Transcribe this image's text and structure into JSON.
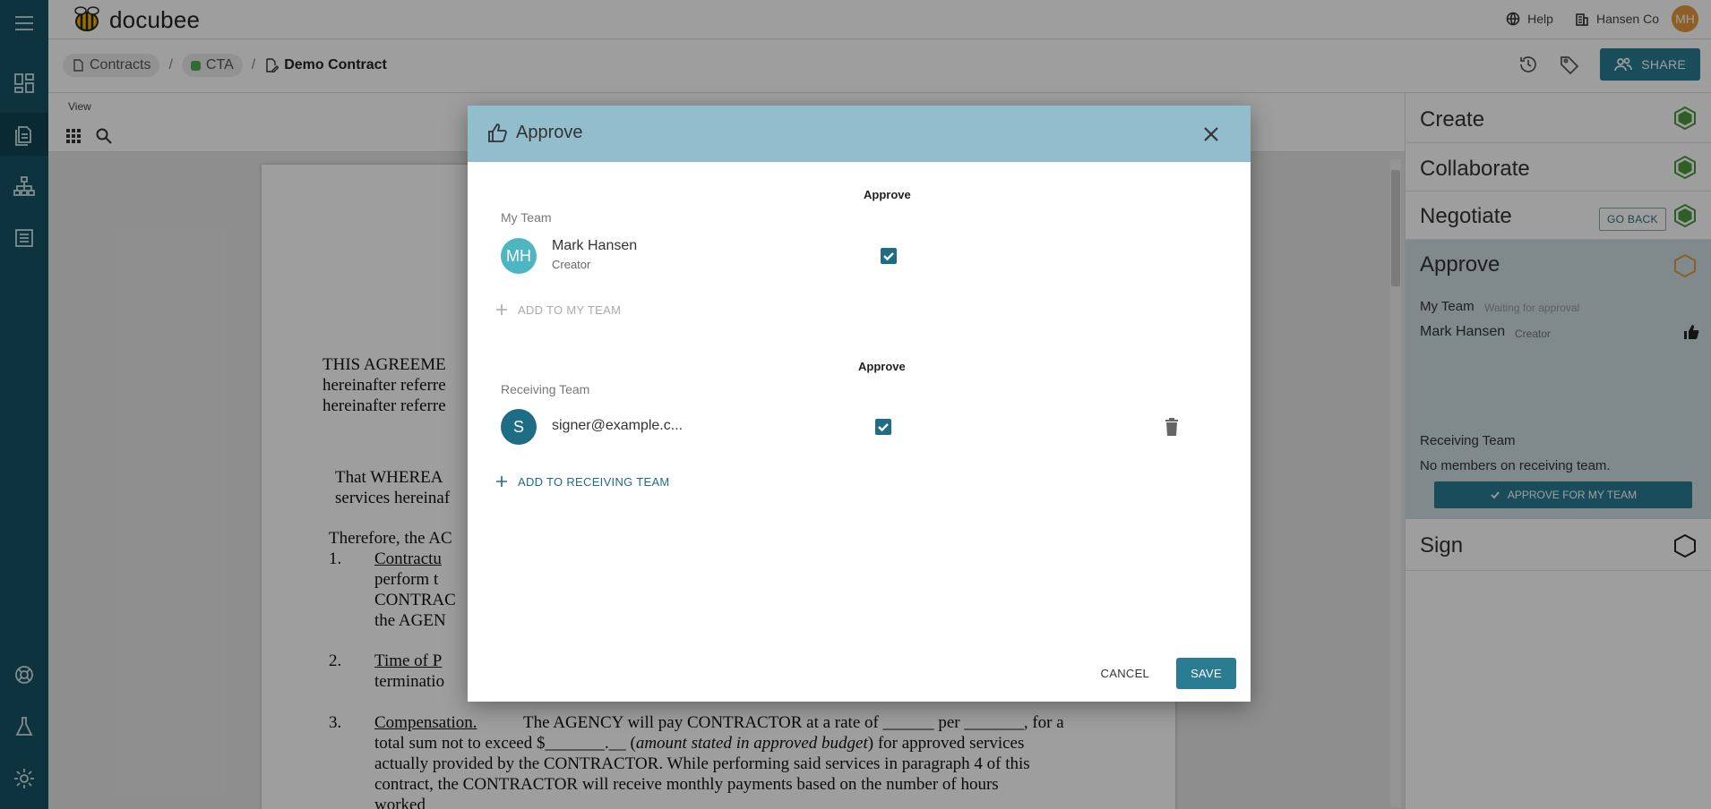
{
  "app": {
    "name": "docubee",
    "help_label": "Help",
    "org_label": "Hansen Co",
    "user_initials": "MH"
  },
  "breadcrumb": {
    "root": "Contracts",
    "folder": "CTA",
    "current": "Demo Contract",
    "share_label": "SHARE"
  },
  "viewer": {
    "view_label": "View"
  },
  "document": {
    "lines": [
      "THIS AGREEME",
      "hereinafter referre",
      "hereinafter referre",
      "That  WHEREA",
      "services hereinaf",
      "Therefore, the AC",
      "1.",
      "Contractu",
      "perform  t",
      "CONTRAC",
      "the AGEN",
      "2.",
      "Time of P",
      "terminatio",
      "3.",
      "Compensation.",
      "The AGENCY will pay CONTRACTOR at a rate of ______ per _______, for a",
      "total sum not to exceed $_______.__ (",
      "amount stated in approved budget",
      ") for approved services",
      "actually provided by the CONTRACTOR.  While performing said services in paragraph 4 of this",
      "contract, the CONTRACTOR will receive monthly payments based on the number of hours",
      "worked"
    ]
  },
  "workflow": {
    "stages": [
      {
        "name": "Create",
        "status": "complete"
      },
      {
        "name": "Collaborate",
        "status": "complete"
      },
      {
        "name": "Negotiate",
        "status": "complete",
        "action": "GO BACK"
      },
      {
        "name": "Approve",
        "status": "in-progress"
      },
      {
        "name": "Sign",
        "status": "pending"
      }
    ],
    "approve_detail": {
      "my_team_label": "My Team",
      "my_team_status": "Waiting for approval",
      "member_name": "Mark Hansen",
      "member_role": "Creator",
      "approve_button": "APPROVE FOR MY TEAM",
      "receiving_team_label": "Receiving Team",
      "receiving_empty": "No members on receiving team."
    }
  },
  "modal": {
    "title": "Approve",
    "my_team": {
      "column_header": "Approve",
      "label": "My Team",
      "members": [
        {
          "initials": "MH",
          "name": "Mark Hansen",
          "role": "Creator",
          "approve": true,
          "avatar_color": "#4db6c0"
        }
      ],
      "add_label": "ADD TO MY TEAM"
    },
    "receiving_team": {
      "column_header": "Approve",
      "label": "Receiving Team",
      "members": [
        {
          "initials": "S",
          "name": "signer@example.c...",
          "approve": true,
          "avatar_color": "#1e6d85"
        }
      ],
      "add_label": "ADD TO RECEIVING TEAM"
    },
    "cancel_label": "CANCEL",
    "save_label": "SAVE"
  },
  "colors": {
    "primary": "#2a7c93",
    "rail": "#155565",
    "modal_header": "#92bdcc",
    "complete": "#4c9a3e",
    "in_progress": "#e59a3b"
  }
}
